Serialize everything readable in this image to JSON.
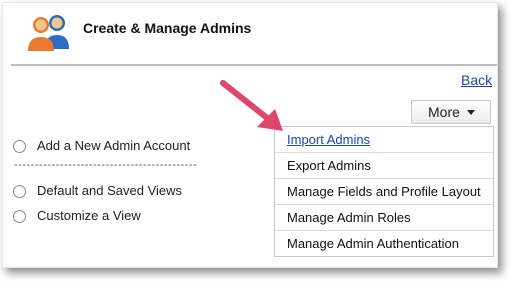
{
  "header": {
    "title": "Create & Manage Admins",
    "icon": "admins-icon"
  },
  "back_link": "Back",
  "more_button": {
    "label": "More",
    "caret": "▾"
  },
  "menu": {
    "items": [
      {
        "label": "Import Admins"
      },
      {
        "label": "Export Admins"
      },
      {
        "label": "Manage Fields and Profile Layout"
      },
      {
        "label": "Manage Admin Roles"
      },
      {
        "label": "Manage Admin Authentication"
      }
    ]
  },
  "options": {
    "add_account": "Add a New Admin Account",
    "separator": "--------------------------------------------",
    "default_views": "Default and Saved Views",
    "customize_view": "Customize a View"
  },
  "colors": {
    "arrow": "#e0456a",
    "link": "#1a44c7",
    "avatar_orange": "#e87b2d",
    "avatar_blue": "#2b6cc4"
  }
}
